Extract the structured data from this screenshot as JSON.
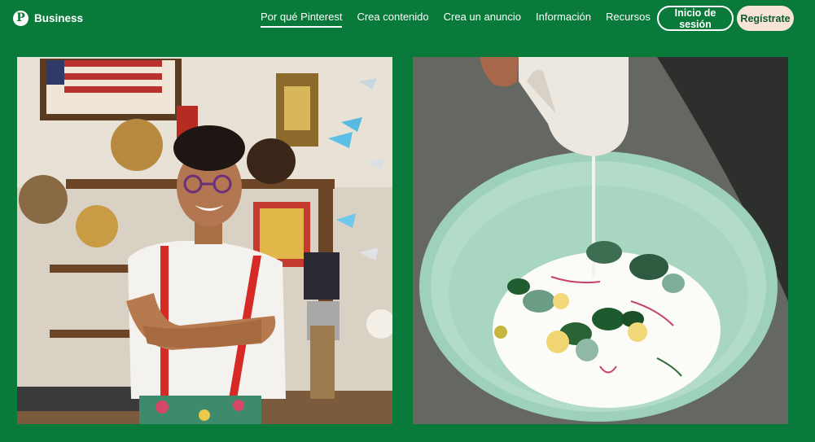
{
  "header": {
    "brand": "Business",
    "nav": [
      {
        "label": "Por qué Pinterest",
        "active": true
      },
      {
        "label": "Crea contenido"
      },
      {
        "label": "Crea un anuncio"
      },
      {
        "label": "Información"
      },
      {
        "label": "Recursos"
      }
    ],
    "login_label": "Inicio de sesión",
    "signup_label": "Regístrate"
  },
  "colors": {
    "background": "#0a7a3b",
    "signup_bg": "#f7e4d6",
    "signup_text": "#0a5a2c"
  },
  "images": [
    {
      "name": "shopkeeper-photo",
      "icon": "photo-shop-owner"
    },
    {
      "name": "food-photo",
      "icon": "photo-soup-pour"
    }
  ]
}
